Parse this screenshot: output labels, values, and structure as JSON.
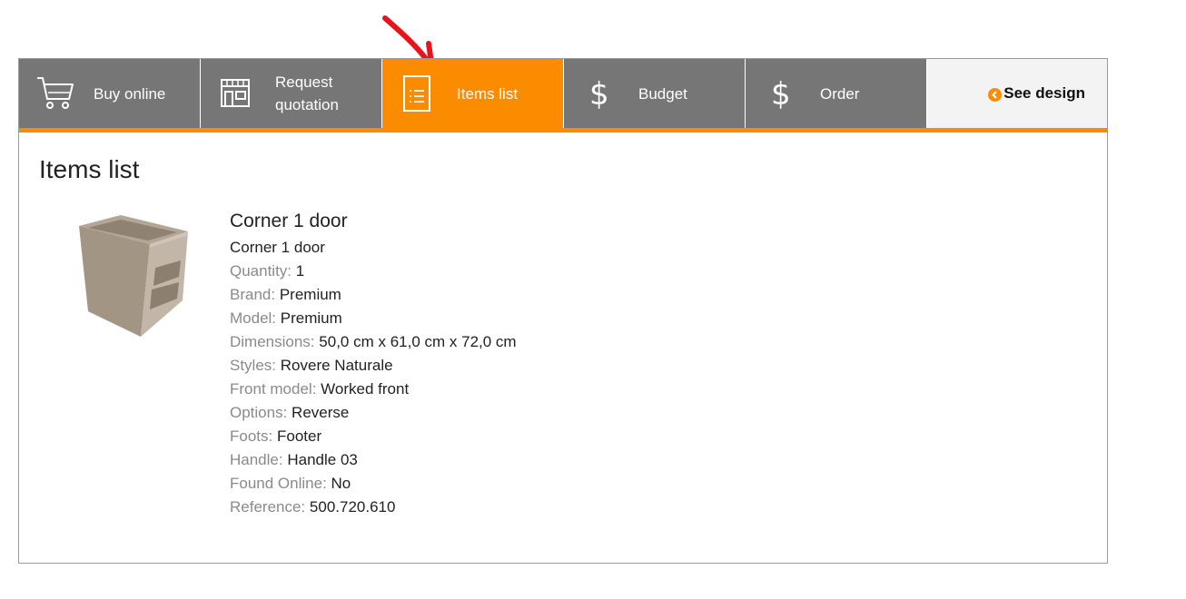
{
  "tabs": [
    {
      "label": "Buy online",
      "icon": "cart-icon",
      "active": false
    },
    {
      "label": "Request quotation",
      "icon": "store-icon",
      "active": false
    },
    {
      "label": "Items list",
      "icon": "document-list-icon",
      "active": true
    },
    {
      "label": "Budget",
      "icon": "dollar-icon",
      "active": false
    },
    {
      "label": "Order",
      "icon": "dollar-icon",
      "active": false
    }
  ],
  "see_design": {
    "label": "See design",
    "icon": "chevron-left-circle-icon"
  },
  "colors": {
    "accent": "#fb8c00",
    "tab_bg": "#767676",
    "annotation_arrow": "#e8141b"
  },
  "page_title": "Items list",
  "item": {
    "thumbnail_icon": "cabinet-3d-icon",
    "name": "Corner 1 door",
    "subtitle": "Corner 1 door",
    "properties": [
      {
        "key": "Quantity:",
        "value": "1"
      },
      {
        "key": "Brand:",
        "value": "Premium"
      },
      {
        "key": "Model:",
        "value": "Premium"
      },
      {
        "key": "Dimensions:",
        "value": "50,0 cm x 61,0 cm x 72,0 cm"
      },
      {
        "key": "Styles:",
        "value": "Rovere Naturale"
      },
      {
        "key": "Front model:",
        "value": "Worked front"
      },
      {
        "key": "Options:",
        "value": "Reverse"
      },
      {
        "key": "Foots:",
        "value": "Footer"
      },
      {
        "key": "Handle:",
        "value": "Handle 03"
      },
      {
        "key": "Found Online:",
        "value": "No"
      },
      {
        "key": "Reference:",
        "value": "500.720.610"
      }
    ]
  }
}
